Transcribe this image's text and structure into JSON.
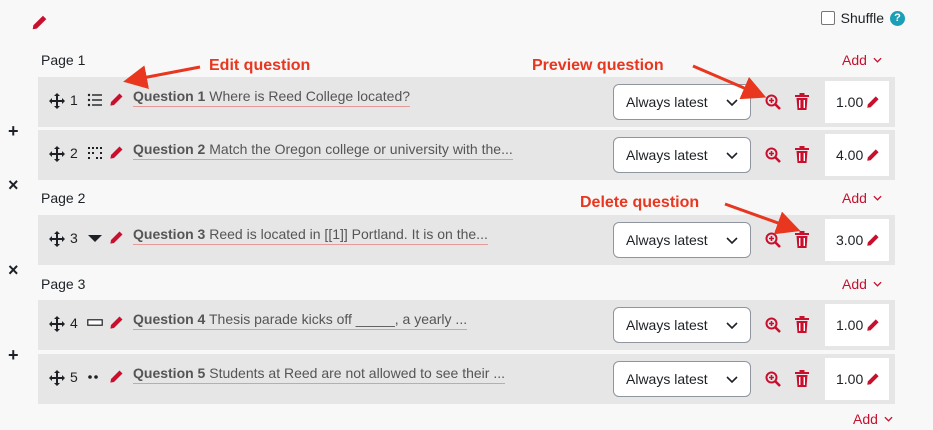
{
  "header": {
    "shuffle_label": "Shuffle",
    "help_glyph": "?"
  },
  "pages": [
    {
      "label": "Page 1",
      "add_label": "Add"
    },
    {
      "label": "Page 2",
      "add_label": "Add"
    },
    {
      "label": "Page 3",
      "add_label": "Add"
    }
  ],
  "last_add_label": "Add",
  "questions": [
    {
      "num": "1",
      "title": "Question 1",
      "text": "Where is Reed College located?",
      "version": "Always latest",
      "mark": "1.00",
      "type_icon": "multichoice-icon"
    },
    {
      "num": "2",
      "title": "Question 2",
      "text": "Match the Oregon college or university with the...",
      "version": "Always latest",
      "mark": "4.00",
      "type_icon": "matching-icon"
    },
    {
      "num": "3",
      "title": "Question 3",
      "text": "Reed is located in [[1]] Portland. It is on the...",
      "version": "Always latest",
      "mark": "3.00",
      "type_icon": "select-missing-words-icon"
    },
    {
      "num": "4",
      "title": "Question 4",
      "text": "Thesis parade kicks off _____, a yearly ...",
      "version": "Always latest",
      "mark": "1.00",
      "type_icon": "short-answer-icon"
    },
    {
      "num": "5",
      "title": "Question 5",
      "text": "Students at Reed are not allowed to see their ...",
      "version": "Always latest",
      "mark": "1.00",
      "type_icon": "true-false-icon"
    }
  ],
  "annotations": {
    "edit": "Edit question",
    "preview": "Preview question",
    "delete": "Delete question"
  },
  "colors": {
    "accent": "#c8102e",
    "annotation": "#e8361f",
    "row_bg": "#e6e6e6",
    "help": "#1b9fb7"
  }
}
